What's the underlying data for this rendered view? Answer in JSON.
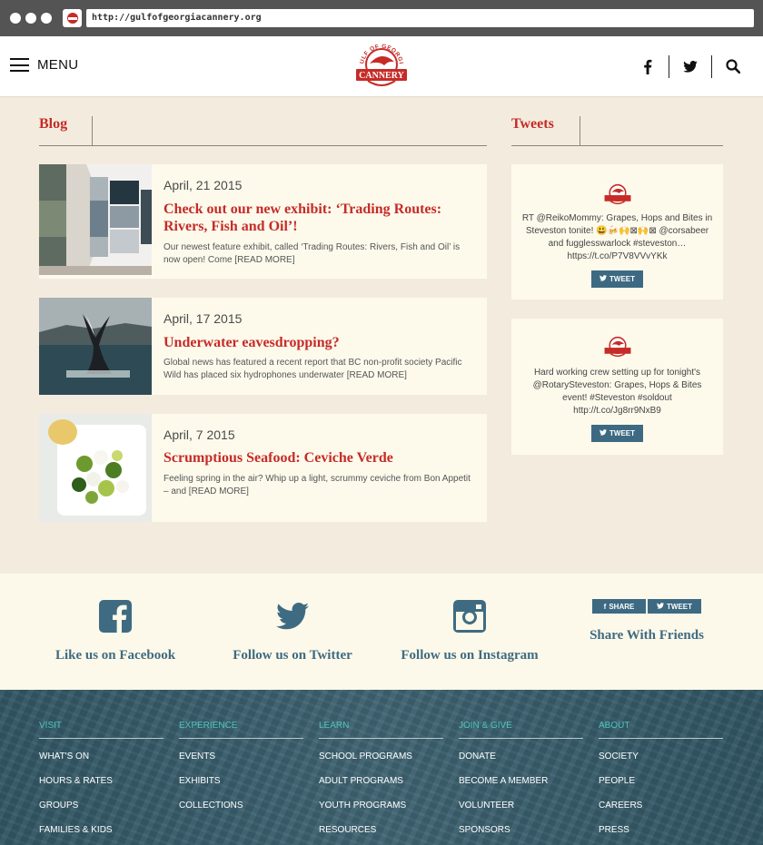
{
  "browser": {
    "url": "http://gulfofgeorgiacannery.org"
  },
  "header": {
    "menu_label": "MENU",
    "logo_text_top": "GULF OF GEORGIA",
    "logo_text_main": "CANNERY",
    "icons": [
      "facebook-icon",
      "twitter-icon",
      "search-icon"
    ]
  },
  "blog": {
    "title": "Blog",
    "posts": [
      {
        "date": "April, 21 2015",
        "title": "Check out our new exhibit: ‘Trading Routes: Rivers, Fish and Oil’!",
        "excerpt": "Our newest feature exhibit, called ‘Trading Routes: Rivers, Fish and Oil’ is now open! Come [READ MORE]"
      },
      {
        "date": "April, 17 2015",
        "title": "Underwater eavesdropping?",
        "excerpt": "Global news has featured a recent report that BC non-profit society Pacific Wild  has placed six hydrophones underwater [READ MORE]"
      },
      {
        "date": "April, 7 2015",
        "title": "Scrumptious Seafood: Ceviche Verde",
        "excerpt": " Feeling spring in the air? Whip up a light, scrummy ceviche from Bon Appetit – and [READ MORE]"
      }
    ]
  },
  "tweets": {
    "title": "Tweets",
    "items": [
      {
        "text": "RT @ReikoMommy: Grapes, Hops and Bites in Steveston tonite! 😃🍻🙌⊠🙌⊠ @corsabeer and fugglesswarlock #steveston… https://t.co/P7V8VVvYKk",
        "button": "TWEET"
      },
      {
        "text": "Hard working crew setting up for tonight's @RotarySteveston: Grapes, Hops & Bites event! #Steveston #soldout http://t.co/Jg8rr9NxB9",
        "button": "TWEET"
      }
    ]
  },
  "social": {
    "facebook_label": "Like us on Facebook",
    "twitter_label": "Follow us on Twitter",
    "instagram_label": "Follow us on Instagram",
    "share_label": "Share With Friends",
    "share_button": "SHARE",
    "tweet_button": "TWEET"
  },
  "footer": {
    "columns": [
      {
        "heading": "VISIT",
        "links": [
          "WHAT'S ON",
          "HOURS & RATES",
          "GROUPS",
          "FAMILIES & KIDS"
        ]
      },
      {
        "heading": "EXPERIENCE",
        "links": [
          "EVENTS",
          "EXHIBITS",
          "COLLECTIONS"
        ]
      },
      {
        "heading": "LEARN",
        "links": [
          "SCHOOL PROGRAMS",
          "ADULT PROGRAMS",
          "YOUTH PROGRAMS",
          "RESOURCES"
        ]
      },
      {
        "heading": "JOIN & GIVE",
        "links": [
          "DONATE",
          "BECOME A MEMBER",
          "VOLUNTEER",
          "SPONSORS"
        ]
      },
      {
        "heading": "ABOUT",
        "links": [
          "SOCIETY",
          "PEOPLE",
          "CAREERS",
          "PRESS"
        ]
      }
    ]
  },
  "colors": {
    "accent_red": "#c62b27",
    "social_blue": "#3f6b82",
    "footer_teal": "#355c6b",
    "footer_heading": "#4ec4bc",
    "background": "#f3ecde"
  }
}
